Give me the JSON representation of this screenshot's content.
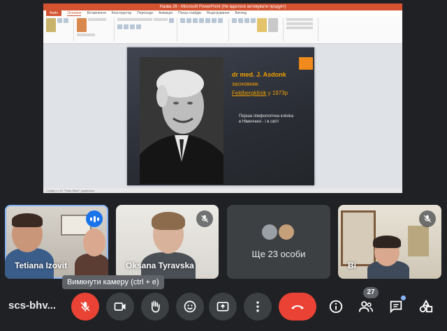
{
  "colors": {
    "background": "#202124",
    "control": "#3c4043",
    "danger": "#ea4335",
    "accent": "#8ab4f8",
    "slide_orange": "#f0a000"
  },
  "presentation": {
    "window_title": "Назва 26 - Microsoft PowerPoint (Не вдалося активувати продукт)",
    "tabs": [
      "Файл",
      "Основне",
      "Вставлення",
      "Конструктор",
      "Переходи",
      "Анімація",
      "Показ слайдів",
      "Рецензування",
      "Вигляд"
    ],
    "status_bar": "Слайд 1 з 24  \"Тема Office\"  українська",
    "slide": {
      "name": "dr med. J. Asdonk",
      "role": "засновник",
      "clinic_link": "Feldbergklinik",
      "clinic_year": "у 1973р",
      "body": "Перша лімфологічна клініка в Німеччині - і в світі"
    }
  },
  "participants": [
    {
      "name": "Tetiana Izovit",
      "speaking": true,
      "muted": false
    },
    {
      "name": "Oksana Tyravska",
      "speaking": false,
      "muted": true
    },
    {
      "name": "Ще 23 особи",
      "speaking": false,
      "muted": false
    },
    {
      "name": "Ві",
      "speaking": false,
      "muted": true
    }
  ],
  "tooltip": "Вимкнути камеру (ctrl + e)",
  "meeting_code": "scs-bhv...",
  "controls": {
    "mic": "mic-off-icon",
    "camera": "videocam-icon",
    "hand": "raise-hand-icon",
    "emoji": "emoji-icon",
    "present": "present-icon",
    "more": "more-vert-icon",
    "leave": "call-end-icon",
    "info": "info-icon",
    "people": "people-icon",
    "people_count": "27",
    "chat": "chat-icon",
    "activities": "activities-icon"
  }
}
